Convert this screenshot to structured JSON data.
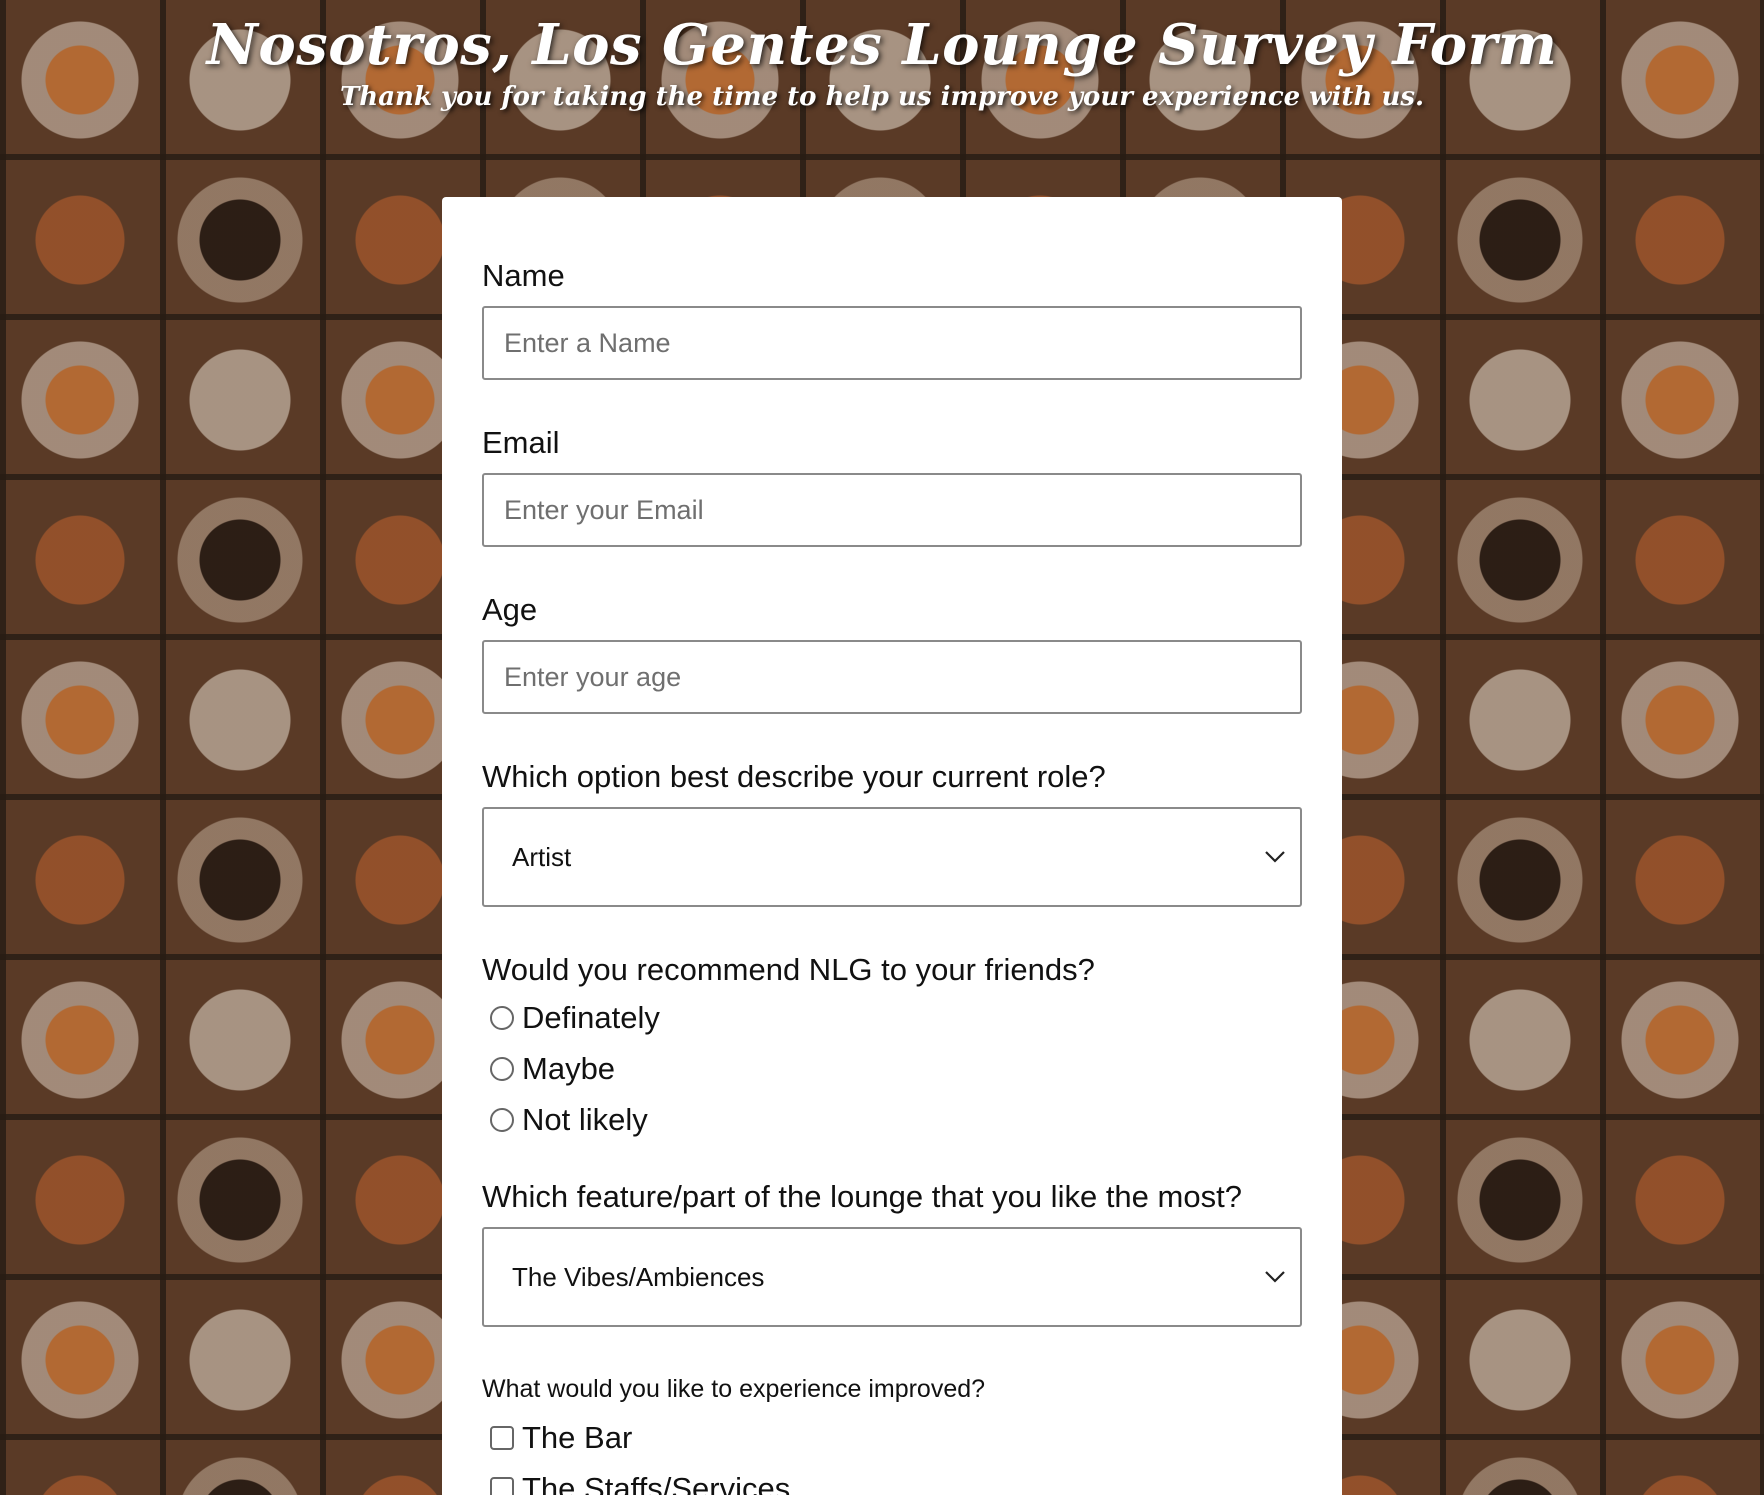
{
  "header": {
    "title": "Nosotros, Los Gentes Lounge Survey Form",
    "subtitle": "Thank you for taking the time to help us improve your experience with us."
  },
  "form": {
    "name": {
      "label": "Name",
      "placeholder": "Enter a Name",
      "value": ""
    },
    "email": {
      "label": "Email",
      "placeholder": "Enter your Email",
      "value": ""
    },
    "age": {
      "label": "Age",
      "placeholder": "Enter your age",
      "value": ""
    },
    "role": {
      "label": "Which option best describe your current role?",
      "selected": "Artist",
      "icon": "chevron-down-icon"
    },
    "recommend": {
      "label": "Would you recommend NLG to your friends?",
      "options": [
        "Definately",
        "Maybe",
        "Not likely"
      ],
      "selected": null
    },
    "feature": {
      "label": "Which feature/part of the lounge that you like the most?",
      "selected": "The Vibes/Ambiences",
      "icon": "chevron-down-icon"
    },
    "improve": {
      "label": "What would you like to experience improved?",
      "options": [
        "The Bar",
        "The Staffs/Services"
      ],
      "checked": []
    }
  },
  "colors": {
    "card_background": "#ffffff",
    "input_border": "#8a8a8a",
    "title_text": "#ffffff"
  }
}
